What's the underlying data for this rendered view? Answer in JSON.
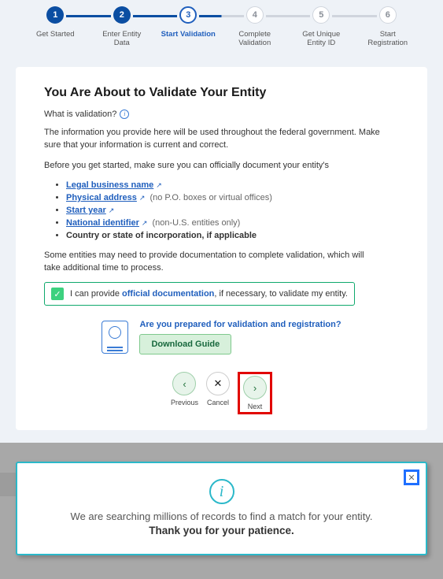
{
  "stepper": {
    "steps": [
      {
        "num": "1",
        "label": "Get Started",
        "state": "completed"
      },
      {
        "num": "2",
        "label": "Enter Entity Data",
        "state": "completed"
      },
      {
        "num": "3",
        "label": "Start Validation",
        "state": "active"
      },
      {
        "num": "4",
        "label": "Complete Validation",
        "state": "pending"
      },
      {
        "num": "5",
        "label": "Get Unique Entity ID",
        "state": "pending"
      },
      {
        "num": "6",
        "label": "Start Registration",
        "state": "pending"
      }
    ]
  },
  "card": {
    "heading": "You Are About to Validate Your Entity",
    "whatis_label": "What is validation?",
    "intro": "The information you provide here will be used throughout the federal government. Make sure that your information is current and correct.",
    "before": "Before you get started, make sure you can officially document your entity's",
    "reqs": {
      "r0": {
        "link": "Legal business name",
        "hint": ""
      },
      "r1": {
        "link": "Physical address",
        "hint": "(no P.O. boxes or virtual offices)"
      },
      "r2": {
        "link": "Start year",
        "hint": ""
      },
      "r3": {
        "link": "National identifier",
        "hint": "(non-U.S. entities only)"
      },
      "r4": {
        "text": "Country or state of incorporation, if applicable"
      }
    },
    "some_entities": "Some entities may need to provide documentation to complete validation, which will take additional time to process.",
    "confirm_prefix": "I can provide ",
    "confirm_bold": "official documentation",
    "confirm_suffix": ", if necessary, to validate my entity.",
    "guide_question": "Are you prepared for validation and registration?",
    "download_label": "Download Guide",
    "nav": {
      "previous": "Previous",
      "cancel": "Cancel",
      "next": "Next"
    }
  },
  "modal": {
    "line1": "We are searching millions of records to find a match for your entity.",
    "line2": "Thank you for your patience."
  }
}
